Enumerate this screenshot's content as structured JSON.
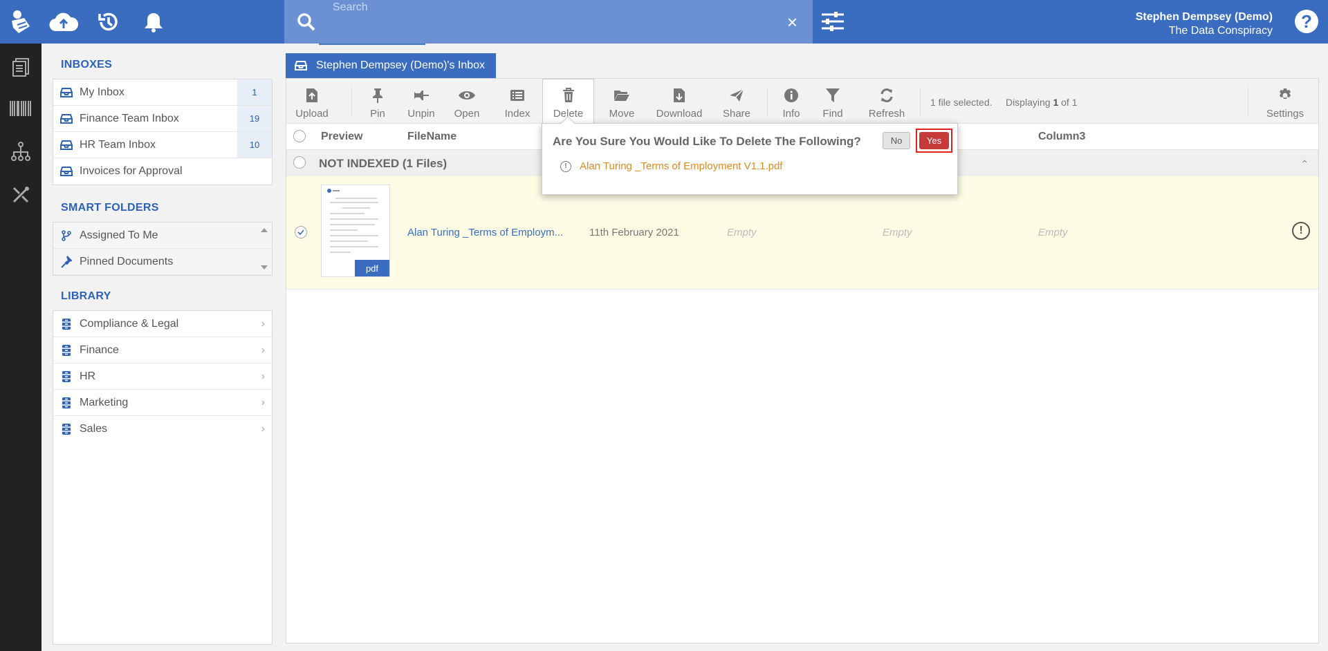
{
  "header": {
    "search_placeholder": "Search",
    "user_name": "Stephen Dempsey (Demo)",
    "user_org": "The Data Conspiracy",
    "help_label": "?"
  },
  "sidebar": {
    "inboxes_title": "INBOXES",
    "inboxes": [
      {
        "label": "My Inbox",
        "count": "1"
      },
      {
        "label": "Finance Team Inbox",
        "count": "19"
      },
      {
        "label": "HR Team Inbox",
        "count": "10"
      },
      {
        "label": "Invoices for Approval",
        "count": ""
      }
    ],
    "smart_title": "SMART FOLDERS",
    "smart_folders": [
      {
        "label": "Assigned To Me"
      },
      {
        "label": "Pinned Documents"
      }
    ],
    "library_title": "LIBRARY",
    "library": [
      {
        "label": "Compliance & Legal"
      },
      {
        "label": "Finance"
      },
      {
        "label": "HR"
      },
      {
        "label": "Marketing"
      },
      {
        "label": "Sales"
      }
    ]
  },
  "main": {
    "tab_label": "Stephen Dempsey (Demo)'s Inbox",
    "toolbar": {
      "upload": "Upload",
      "pin": "Pin",
      "unpin": "Unpin",
      "open": "Open",
      "index": "Index",
      "delete": "Delete",
      "move": "Move",
      "download": "Download",
      "share": "Share",
      "info": "Info",
      "find": "Find",
      "refresh": "Refresh",
      "settings": "Settings",
      "selected_text": "1 file selected.",
      "displaying_prefix": "Displaying",
      "displaying_current": "1",
      "displaying_suffix": "of 1"
    },
    "columns": {
      "preview": "Preview",
      "filename": "FileName",
      "column3": "Column3"
    },
    "group": {
      "label": "NOT INDEXED  (1 Files)"
    },
    "row": {
      "filename": "Alan Turing _Terms of Employm...",
      "date": "11th February 2021",
      "col_a": "Empty",
      "col_b": "Empty",
      "col_c": "Empty",
      "badge": "pdf",
      "status_icon": "!"
    }
  },
  "dialog": {
    "question": "Are You Sure You Would Like To Delete The Following?",
    "no_label": "No",
    "yes_label": "Yes",
    "file": "Alan Turing _Terms of Employment V1.1.pdf",
    "warn_icon": "!"
  },
  "colors": {
    "brand_blue": "#3a6cc0",
    "yes_red": "#c73a3a",
    "file_orange": "#e08a1e",
    "row_highlight": "#fdfde6"
  }
}
